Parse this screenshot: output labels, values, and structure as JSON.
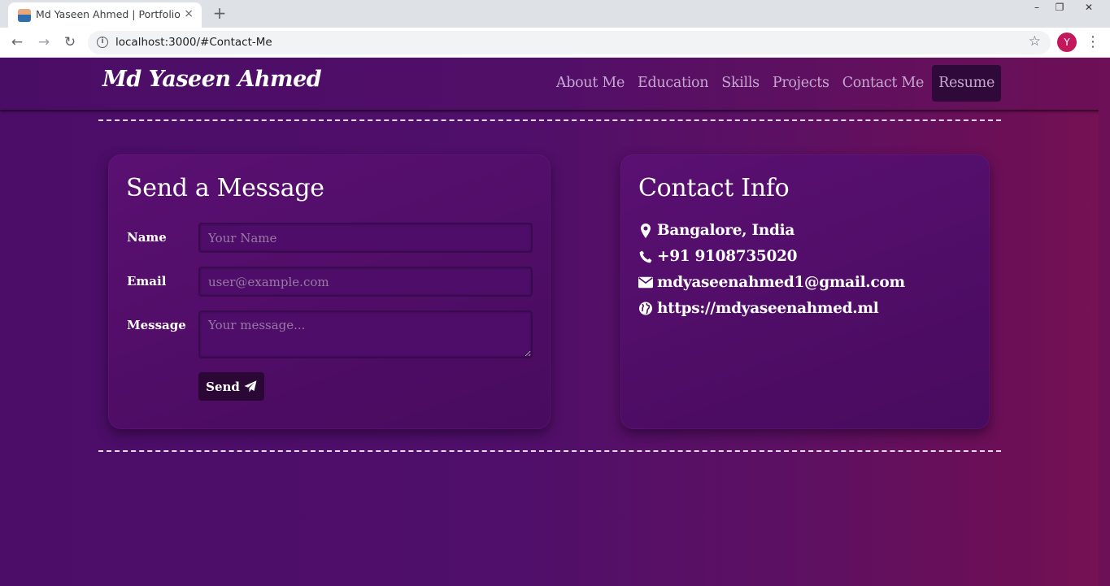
{
  "browser": {
    "tab_title": "Md Yaseen Ahmed | Portfolio",
    "tab_close": "×",
    "new_tab": "+",
    "url": "localhost:3000/#Contact-Me",
    "profile_initial": "Y",
    "controls": {
      "minimize": "–",
      "maximize": "❐",
      "close": "✕"
    },
    "icons": {
      "back": "←",
      "forward": "→",
      "reload": "↻",
      "info": "i",
      "bookmark": "☆",
      "menu": "⋮"
    }
  },
  "header": {
    "brand": "Md Yaseen Ahmed",
    "nav": [
      "About Me",
      "Education",
      "Skills",
      "Projects",
      "Contact Me"
    ],
    "resume": "Resume"
  },
  "form": {
    "title": "Send a Message",
    "name_label": "Name",
    "name_placeholder": "Your Name",
    "email_label": "Email",
    "email_placeholder": "user@example.com",
    "message_label": "Message",
    "message_placeholder": "Your message...",
    "send_label": "Send",
    "send_icon": "paper-plane-icon"
  },
  "contact": {
    "title": "Contact Info",
    "location": "Bangalore, India",
    "phone": "+91 9108735020",
    "email": "mdyaseenahmed1@gmail.com",
    "website": "https://mdyaseenahmed.ml",
    "icons": [
      "map-marker-icon",
      "phone-icon",
      "envelope-icon",
      "globe-icon"
    ]
  },
  "colors": {
    "page_left": "#4b0d68",
    "page_right": "#761253",
    "card": "#520f6a",
    "button": "#2a0734",
    "nav_text": "#c7a6d1",
    "divider": "#e8d9ee"
  }
}
